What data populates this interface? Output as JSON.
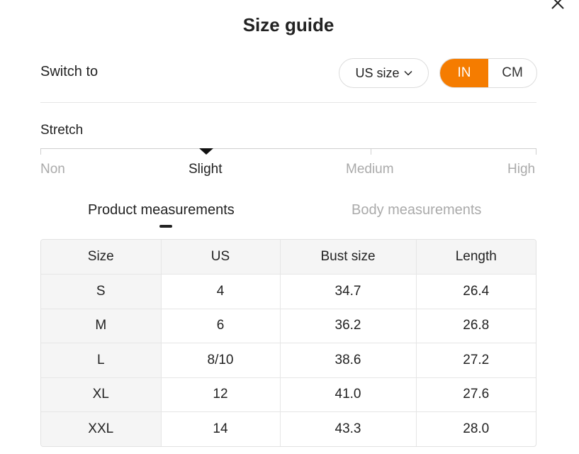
{
  "dialog": {
    "title": "Size guide",
    "close_icon": "close-icon"
  },
  "switch": {
    "label": "Switch to",
    "size_system": "US size",
    "units": [
      {
        "label": "IN",
        "active": true
      },
      {
        "label": "CM",
        "active": false
      }
    ]
  },
  "stretch": {
    "label": "Stretch",
    "levels": [
      "Non",
      "Slight",
      "Medium",
      "High"
    ],
    "selected": "Slight"
  },
  "tabs": [
    {
      "label": "Product measurements",
      "active": true
    },
    {
      "label": "Body measurements",
      "active": false
    }
  ],
  "table": {
    "headers": [
      "Size",
      "US",
      "Bust size",
      "Length"
    ],
    "rows": [
      [
        "S",
        "4",
        "34.7",
        "26.4"
      ],
      [
        "M",
        "6",
        "36.2",
        "26.8"
      ],
      [
        "L",
        "8/10",
        "38.6",
        "27.2"
      ],
      [
        "XL",
        "12",
        "41.0",
        "27.6"
      ],
      [
        "XXL",
        "14",
        "43.3",
        "28.0"
      ]
    ]
  },
  "colors": {
    "accent": "#f57c00",
    "text": "#222222",
    "muted": "#aaaaaa",
    "header_bg": "#f5f5f5"
  }
}
